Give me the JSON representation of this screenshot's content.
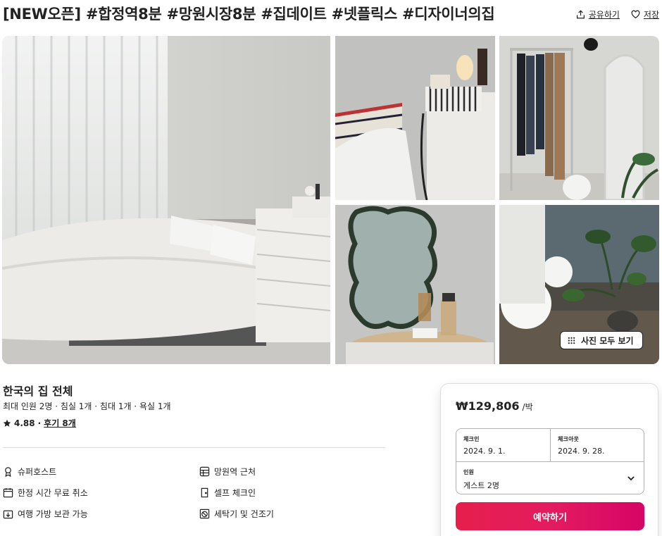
{
  "header": {
    "title": "[NEW오픈] #합정역8분 #망원시장8분 #집데이트 #넷플릭스 #디자이너의집",
    "share_label": "공유하기",
    "save_label": "저장",
    "share_icon": "share-icon",
    "save_icon": "heart-icon"
  },
  "gallery": {
    "show_all_label": "사진 모두 보기",
    "show_all_icon": "grid-dots-icon",
    "photos": [
      "bedroom",
      "headboard-lamp",
      "clothing-rack-mirror",
      "wavy-mirror-vanity",
      "globe-lamps-plant"
    ]
  },
  "listing": {
    "title": "한국의 집 전체",
    "meta": "최대 인원 2명 · 침실 1개 · 침대 1개 · 욕실 1개",
    "rating": "4.88",
    "separator": "·",
    "reviews": "후기 8개"
  },
  "features": [
    {
      "icon": "medal-icon",
      "label": "슈퍼호스트"
    },
    {
      "icon": "calendar-icon",
      "label": "한정 시간 무료 취소"
    },
    {
      "icon": "luggage-icon",
      "label": "여행 가방 보관 가능"
    },
    {
      "icon": "map-icon",
      "label": "망원역 근처"
    },
    {
      "icon": "door-icon",
      "label": "셀프 체크인"
    },
    {
      "icon": "no-washer-icon",
      "label": "세탁기 및 건조기"
    }
  ],
  "booking": {
    "price": "₩129,806",
    "per": "/박",
    "checkin_label": "체크인",
    "checkin_value": "2024. 9. 1.",
    "checkout_label": "체크아웃",
    "checkout_value": "2024. 9. 28.",
    "guests_label": "인원",
    "guests_value": "게스트 2명",
    "reserve_label": "예약하기"
  },
  "colors": {
    "brand": "#e61e4d",
    "text": "#222222",
    "border": "#dddddd"
  }
}
